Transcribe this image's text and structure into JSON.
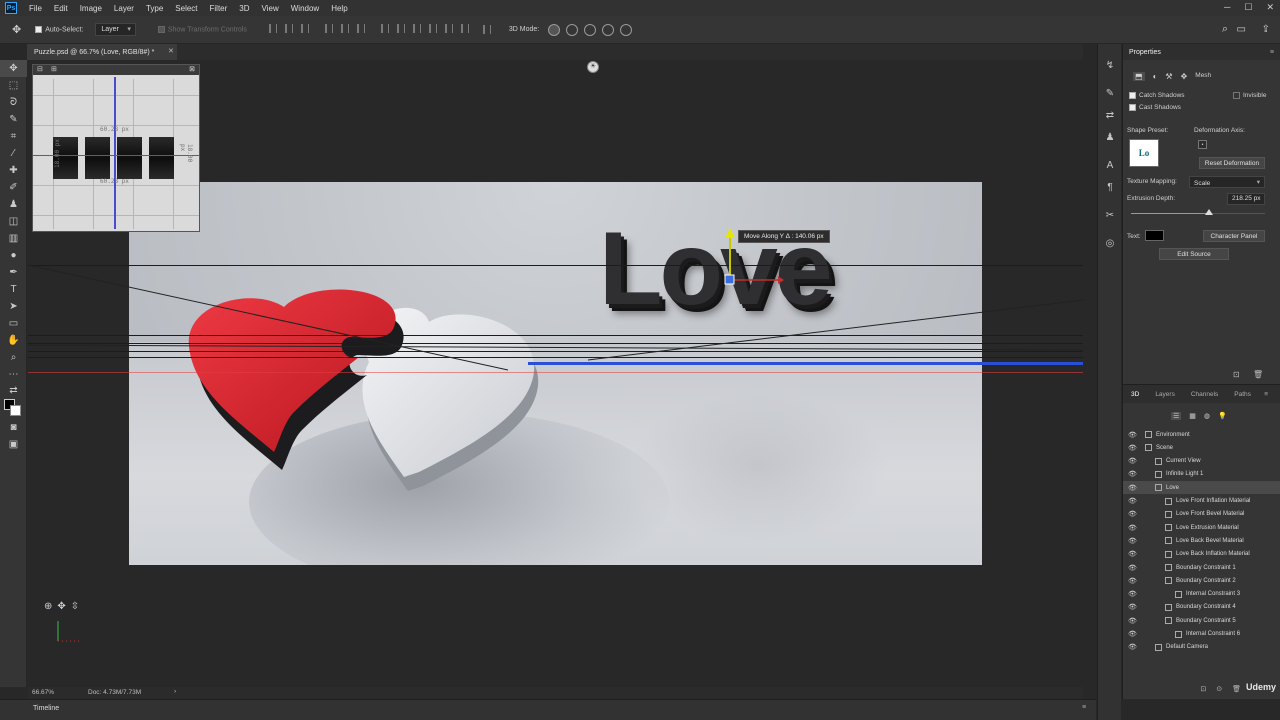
{
  "menubar": {
    "logo": "Ps",
    "items": [
      "File",
      "Edit",
      "Image",
      "Layer",
      "Type",
      "Select",
      "Filter",
      "3D",
      "View",
      "Window",
      "Help"
    ]
  },
  "options": {
    "auto_select_label": "Auto-Select:",
    "auto_select_value": "Layer",
    "show_transform": "Show Transform Controls",
    "mode_3d": "3D Mode:"
  },
  "document": {
    "tab_title": "Puzzle.psd @ 66.7% (Love, RGB/8#) *",
    "love_text": "Love",
    "tooltip": "Move Along Y  Δ :  140.06 px",
    "mini_labels": {
      "top": "60.28 px",
      "bottom": "60.28 px",
      "left": "18.00 px",
      "right": "18.00 px"
    }
  },
  "status": {
    "zoom": "66.67%",
    "doc": "Doc: 4.73M/7.73M",
    "timeline": "Timeline"
  },
  "properties": {
    "title": "Properties",
    "mesh_label": "Mesh",
    "catch_shadows": "Catch Shadows",
    "cast_shadows": "Cast Shadows",
    "invisible": "Invisible",
    "shape_preset": "Shape Preset:",
    "preset_thumb": "Lo",
    "deformation_axis": "Deformation Axis:",
    "reset_deformation": "Reset Deformation",
    "texture_mapping_label": "Texture Mapping:",
    "texture_mapping_value": "Scale",
    "extrusion_label": "Extrusion Depth:",
    "extrusion_value": "218.25 px",
    "extrusion_fraction": 0.58,
    "text_label": "Text:",
    "character_panel": "Character Panel",
    "edit_source": "Edit Source"
  },
  "layers_panel": {
    "tabs": [
      "3D",
      "Layers",
      "Channels",
      "Paths"
    ],
    "rows": [
      {
        "label": "Environment",
        "indent": 0,
        "eye": true
      },
      {
        "label": "Scene",
        "indent": 0,
        "eye": true
      },
      {
        "label": "Current View",
        "indent": 1,
        "eye": true
      },
      {
        "label": "Infinite Light 1",
        "indent": 1,
        "eye": true
      },
      {
        "label": "Love",
        "indent": 1,
        "eye": true,
        "selected": true
      },
      {
        "label": "Love Front Inflation Material",
        "indent": 2,
        "eye": true
      },
      {
        "label": "Love Front Bevel Material",
        "indent": 2,
        "eye": true
      },
      {
        "label": "Love Extrusion Material",
        "indent": 2,
        "eye": true
      },
      {
        "label": "Love Back Bevel Material",
        "indent": 2,
        "eye": true
      },
      {
        "label": "Love Back Inflation Material",
        "indent": 2,
        "eye": true
      },
      {
        "label": "Boundary Constraint 1",
        "indent": 2,
        "eye": true
      },
      {
        "label": "Boundary Constraint 2",
        "indent": 2,
        "eye": true
      },
      {
        "label": "Internal Constraint 3",
        "indent": 3,
        "eye": true
      },
      {
        "label": "Boundary Constraint 4",
        "indent": 2,
        "eye": true
      },
      {
        "label": "Boundary Constraint 5",
        "indent": 2,
        "eye": true
      },
      {
        "label": "Internal Constraint 6",
        "indent": 3,
        "eye": true
      },
      {
        "label": "Default Camera",
        "indent": 1,
        "eye": true
      }
    ]
  },
  "watermark": "Udemy",
  "colors": {
    "heart_red": "#d8242f",
    "text_swatch": "#000000",
    "accent_blue": "#2a4ed8"
  }
}
